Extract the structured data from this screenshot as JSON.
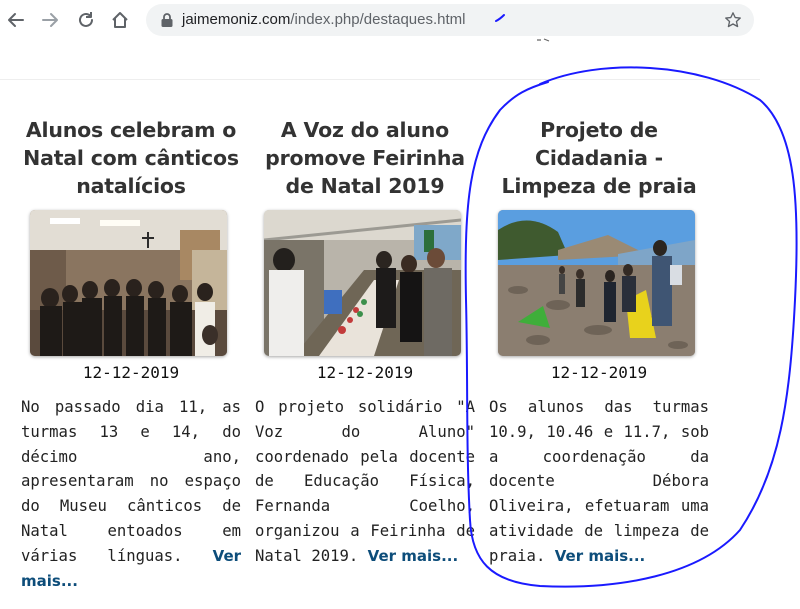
{
  "browser": {
    "url_host": "jaimemoniz.com",
    "url_path": "/index.php/destaques.html",
    "icons": [
      "back-arrow-icon",
      "forward-arrow-icon",
      "reload-icon",
      "home-icon",
      "lock-icon",
      "star-icon"
    ]
  },
  "articles": [
    {
      "title": "Alunos celebram o Natal com cânticos natalícios",
      "date": "12-12-2019",
      "text": "No passado dia 11, as turmas 13 e 14, do décimo ano, apresentaram no espaço do Museu cânticos de Natal entoados em várias línguas.",
      "more": "Ver mais..."
    },
    {
      "title": "A Voz do aluno promove Feirinha de Natal 2019",
      "date": "12-12-2019",
      "text": "O projeto solidário \"A Voz do Aluno\" coordenado pela docente de Educação Física, Fernanda Coelho, organizou a Feirinha de Natal 2019.",
      "more": "Ver mais..."
    },
    {
      "title": "Projeto de Cidadania - Limpeza de praia",
      "date": "12-12-2019",
      "text": "Os alunos das turmas 10.9, 10.46 e 11.7, sob a coordenação da docente Débora Oliveira, efetuaram uma atividade de limpeza de praia.",
      "more": "Ver mais..."
    }
  ],
  "colors": {
    "link": "#0d4d7a",
    "annotation": "#1a1aff",
    "omnibox": "#f1f3f4"
  }
}
